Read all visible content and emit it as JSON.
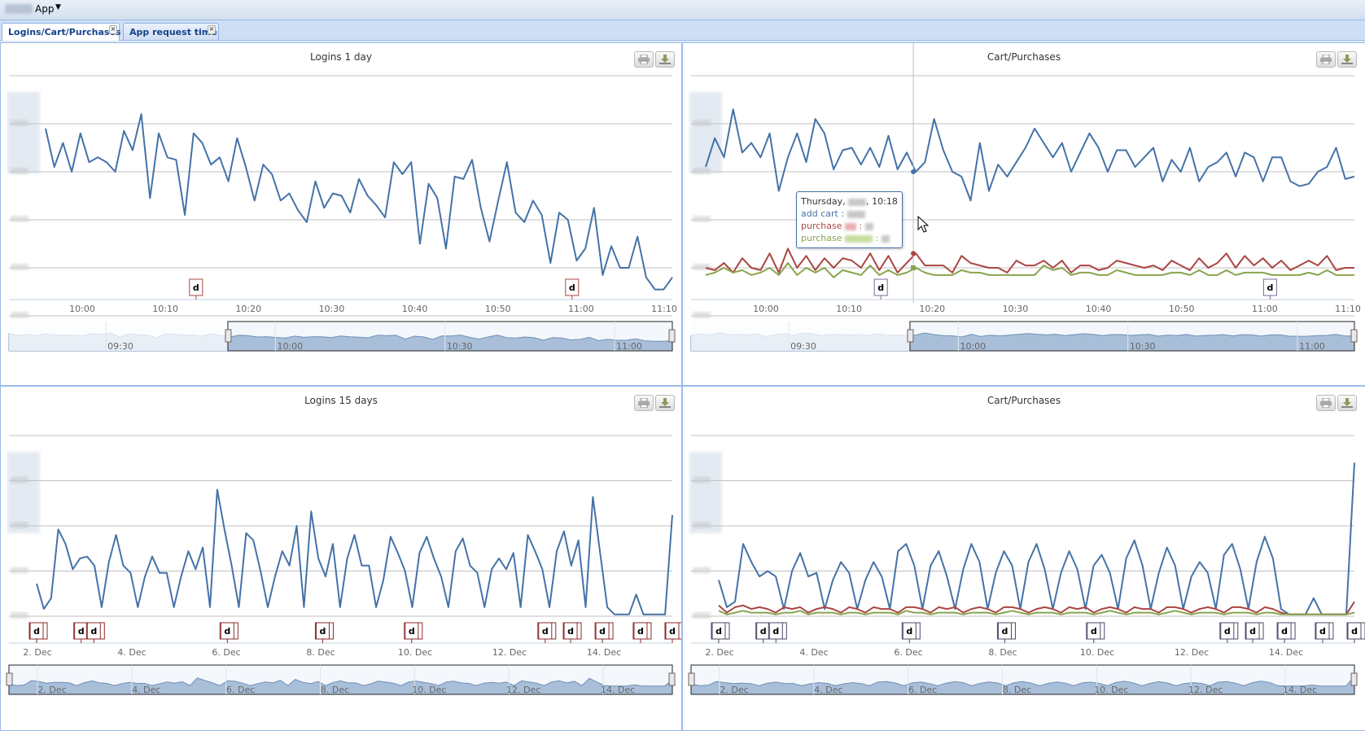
{
  "topbar": {
    "app_label": "App"
  },
  "tabs": [
    {
      "label": "Logins/Cart/Purchases",
      "active": true
    },
    {
      "label": "App request time",
      "active": false
    }
  ],
  "colors": {
    "blue": "#4572a7",
    "red": "#aa4643",
    "green": "#89a54e",
    "nav_fill": "#a9bfd9",
    "grid": "#c0c0c0"
  },
  "icons": {
    "print": "print-icon",
    "export": "download-icon"
  },
  "chart_data": [
    {
      "type": "line",
      "title": "Logins 1 day",
      "x_ticks": [
        "10:00",
        "10:10",
        "10:20",
        "10:30",
        "10:40",
        "10:50",
        "11:00",
        "11:10"
      ],
      "series": [
        {
          "color": "#4572a7",
          "values": [
            0.78,
            0.62,
            0.72,
            0.6,
            0.76,
            0.64,
            0.66,
            0.64,
            0.6,
            0.77,
            0.69,
            0.84,
            0.49,
            0.76,
            0.66,
            0.65,
            0.42,
            0.76,
            0.72,
            0.63,
            0.66,
            0.56,
            0.74,
            0.62,
            0.48,
            0.63,
            0.59,
            0.48,
            0.51,
            0.44,
            0.39,
            0.56,
            0.45,
            0.51,
            0.5,
            0.43,
            0.57,
            0.5,
            0.46,
            0.41,
            0.64,
            0.59,
            0.64,
            0.3,
            0.55,
            0.49,
            0.28,
            0.58,
            0.57,
            0.65,
            0.45,
            0.31,
            0.48,
            0.64,
            0.43,
            0.39,
            0.48,
            0.42,
            0.22,
            0.43,
            0.4,
            0.23,
            0.28,
            0.45,
            0.17,
            0.29,
            0.2,
            0.2,
            0.33,
            0.16,
            0.11,
            0.11,
            0.16
          ]
        }
      ],
      "flags": [
        {
          "label": "d",
          "t": 0.24
        },
        {
          "label": "d",
          "t": 0.84
        }
      ],
      "navigator": {
        "tick_labels": [
          "09:30",
          "10:00",
          "10:30",
          "11:00"
        ],
        "selection": [
          0.33,
          1.0
        ]
      }
    },
    {
      "type": "line",
      "title": "Cart/Purchases",
      "x_ticks": [
        "10:00",
        "10:10",
        "10:20",
        "10:30",
        "10:40",
        "10:50",
        "11:00",
        "11:10"
      ],
      "series": [
        {
          "name": "add cart",
          "color": "#4572a7",
          "values": [
            0.62,
            0.74,
            0.66,
            0.86,
            0.68,
            0.72,
            0.66,
            0.76,
            0.52,
            0.66,
            0.76,
            0.64,
            0.82,
            0.76,
            0.61,
            0.69,
            0.7,
            0.63,
            0.7,
            0.62,
            0.75,
            0.61,
            0.68,
            0.6,
            0.64,
            0.82,
            0.69,
            0.6,
            0.58,
            0.48,
            0.72,
            0.52,
            0.63,
            0.58,
            0.64,
            0.7,
            0.78,
            0.72,
            0.66,
            0.72,
            0.6,
            0.68,
            0.76,
            0.7,
            0.6,
            0.69,
            0.69,
            0.62,
            0.66,
            0.7,
            0.56,
            0.65,
            0.6,
            0.7,
            0.56,
            0.62,
            0.64,
            0.68,
            0.58,
            0.68,
            0.66,
            0.56,
            0.66,
            0.66,
            0.56,
            0.54,
            0.55,
            0.6,
            0.62,
            0.7,
            0.57,
            0.58
          ]
        },
        {
          "name": "purchase",
          "color": "#aa4643",
          "values": [
            0.2,
            0.19,
            0.22,
            0.18,
            0.24,
            0.2,
            0.19,
            0.26,
            0.18,
            0.28,
            0.2,
            0.25,
            0.19,
            0.24,
            0.2,
            0.24,
            0.23,
            0.2,
            0.26,
            0.19,
            0.25,
            0.18,
            0.22,
            0.26,
            0.21,
            0.21,
            0.21,
            0.18,
            0.25,
            0.22,
            0.21,
            0.2,
            0.2,
            0.18,
            0.23,
            0.21,
            0.21,
            0.23,
            0.2,
            0.23,
            0.18,
            0.21,
            0.21,
            0.19,
            0.2,
            0.23,
            0.22,
            0.21,
            0.2,
            0.21,
            0.19,
            0.23,
            0.21,
            0.19,
            0.24,
            0.2,
            0.22,
            0.26,
            0.2,
            0.25,
            0.21,
            0.24,
            0.2,
            0.23,
            0.19,
            0.21,
            0.23,
            0.21,
            0.25,
            0.19,
            0.2,
            0.2
          ]
        },
        {
          "name": "purchase",
          "color": "#89a54e",
          "values": [
            0.17,
            0.18,
            0.2,
            0.18,
            0.19,
            0.17,
            0.18,
            0.2,
            0.17,
            0.22,
            0.17,
            0.2,
            0.18,
            0.2,
            0.16,
            0.19,
            0.18,
            0.17,
            0.21,
            0.17,
            0.19,
            0.17,
            0.18,
            0.2,
            0.18,
            0.17,
            0.17,
            0.17,
            0.19,
            0.18,
            0.18,
            0.17,
            0.17,
            0.17,
            0.17,
            0.17,
            0.17,
            0.21,
            0.19,
            0.2,
            0.17,
            0.18,
            0.18,
            0.17,
            0.17,
            0.19,
            0.18,
            0.17,
            0.17,
            0.17,
            0.17,
            0.18,
            0.18,
            0.17,
            0.19,
            0.17,
            0.17,
            0.19,
            0.17,
            0.18,
            0.18,
            0.18,
            0.17,
            0.17,
            0.17,
            0.17,
            0.18,
            0.17,
            0.19,
            0.17,
            0.17,
            0.17
          ]
        }
      ],
      "flags": [
        {
          "label": "d",
          "t": 0.27
        },
        {
          "label": "d",
          "t": 0.87
        }
      ],
      "crosshair_t": 0.32,
      "navigator": {
        "tick_labels": [
          "09:30",
          "10:00",
          "10:30",
          "11:00"
        ],
        "selection": [
          0.33,
          1.0
        ]
      },
      "tooltip": {
        "day": "Thursday,",
        "time": ", 10:18",
        "rows": [
          {
            "name": "add cart",
            "color": "#4572a7"
          },
          {
            "name": "purchase",
            "color": "#aa4643"
          },
          {
            "name": "purchase",
            "color": "#89a54e"
          }
        ]
      }
    },
    {
      "type": "line",
      "title": "Logins 15 days",
      "x_ticks": [
        "2. Dec",
        "4. Dec",
        "6. Dec",
        "8. Dec",
        "10. Dec",
        "12. Dec",
        "14. Dec"
      ],
      "series": [
        {
          "color": "#4572a7",
          "values": [
            0.18,
            0.04,
            0.1,
            0.48,
            0.4,
            0.26,
            0.32,
            0.33,
            0.28,
            0.05,
            0.3,
            0.45,
            0.28,
            0.24,
            0.05,
            0.22,
            0.33,
            0.24,
            0.24,
            0.05,
            0.22,
            0.36,
            0.26,
            0.38,
            0.05,
            0.7,
            0.48,
            0.28,
            0.05,
            0.46,
            0.42,
            0.25,
            0.05,
            0.22,
            0.36,
            0.28,
            0.5,
            0.05,
            0.58,
            0.32,
            0.22,
            0.4,
            0.05,
            0.32,
            0.45,
            0.28,
            0.28,
            0.05,
            0.2,
            0.44,
            0.35,
            0.25,
            0.05,
            0.35,
            0.44,
            0.32,
            0.22,
            0.05,
            0.36,
            0.43,
            0.28,
            0.24,
            0.05,
            0.26,
            0.32,
            0.26,
            0.35,
            0.05,
            0.45,
            0.36,
            0.26,
            0.05,
            0.36,
            0.47,
            0.28,
            0.42,
            0.05,
            0.66,
            0.35,
            0.05,
            0.01,
            0.01,
            0.01,
            0.12,
            0.01,
            0.01,
            0.01,
            0.01,
            0.56
          ]
        }
      ],
      "flags": [
        {
          "label": "d",
          "t": 0.0
        },
        {
          "label": "d",
          "t": 0.07
        },
        {
          "label": "d",
          "t": 0.09
        },
        {
          "label": "d",
          "t": 0.3
        },
        {
          "label": "d",
          "t": 0.45
        },
        {
          "label": "d",
          "t": 0.59
        },
        {
          "label": "d",
          "t": 0.8
        },
        {
          "label": "d",
          "t": 0.84
        },
        {
          "label": "d",
          "t": 0.89
        },
        {
          "label": "d",
          "t": 0.95
        },
        {
          "label": "d",
          "t": 1.0
        }
      ],
      "navigator": {
        "tick_labels": [
          "2. Dec",
          "4. Dec",
          "6. Dec",
          "8. Dec",
          "10. Dec",
          "12. Dec",
          "14. Dec"
        ],
        "selection": [
          0.0,
          1.0
        ]
      }
    },
    {
      "type": "line",
      "title": "Cart/Purchases",
      "x_ticks": [
        "2. Dec",
        "4. Dec",
        "6. Dec",
        "8. Dec",
        "10. Dec",
        "12. Dec",
        "14. Dec"
      ],
      "series": [
        {
          "color": "#4572a7",
          "values": [
            0.2,
            0.05,
            0.08,
            0.4,
            0.3,
            0.22,
            0.25,
            0.22,
            0.04,
            0.25,
            0.35,
            0.22,
            0.24,
            0.04,
            0.2,
            0.3,
            0.24,
            0.04,
            0.2,
            0.3,
            0.22,
            0.04,
            0.36,
            0.4,
            0.28,
            0.04,
            0.28,
            0.36,
            0.22,
            0.04,
            0.26,
            0.4,
            0.3,
            0.04,
            0.24,
            0.36,
            0.28,
            0.04,
            0.3,
            0.4,
            0.26,
            0.04,
            0.24,
            0.36,
            0.26,
            0.04,
            0.28,
            0.34,
            0.24,
            0.04,
            0.32,
            0.42,
            0.28,
            0.04,
            0.24,
            0.38,
            0.28,
            0.04,
            0.22,
            0.3,
            0.24,
            0.04,
            0.34,
            0.4,
            0.26,
            0.04,
            0.3,
            0.44,
            0.32,
            0.04,
            0.01,
            0.01,
            0.01,
            0.1,
            0.01,
            0.01,
            0.01,
            0.01,
            0.85
          ]
        },
        {
          "color": "#aa4643",
          "values": [
            0.06,
            0.02,
            0.05,
            0.06,
            0.04,
            0.05,
            0.04,
            0.02,
            0.05,
            0.04,
            0.05,
            0.02,
            0.04,
            0.05,
            0.04,
            0.02,
            0.05,
            0.04,
            0.02,
            0.05,
            0.04,
            0.04,
            0.02,
            0.05,
            0.05,
            0.04,
            0.02,
            0.05,
            0.04,
            0.05,
            0.02,
            0.04,
            0.05,
            0.04,
            0.02,
            0.05,
            0.05,
            0.04,
            0.02,
            0.04,
            0.05,
            0.04,
            0.02,
            0.05,
            0.04,
            0.05,
            0.02,
            0.04,
            0.05,
            0.04,
            0.02,
            0.05,
            0.04,
            0.04,
            0.02,
            0.05,
            0.05,
            0.04,
            0.02,
            0.04,
            0.05,
            0.04,
            0.02,
            0.05,
            0.05,
            0.04,
            0.02,
            0.05,
            0.04,
            0.02,
            0.01,
            0.01,
            0.01,
            0.01,
            0.01,
            0.01,
            0.01,
            0.01,
            0.08
          ]
        },
        {
          "color": "#89a54e",
          "values": [
            0.03,
            0.01,
            0.02,
            0.03,
            0.02,
            0.02,
            0.02,
            0.01,
            0.02,
            0.02,
            0.03,
            0.01,
            0.02,
            0.02,
            0.02,
            0.01,
            0.02,
            0.02,
            0.01,
            0.02,
            0.02,
            0.02,
            0.01,
            0.03,
            0.02,
            0.02,
            0.01,
            0.02,
            0.02,
            0.02,
            0.01,
            0.02,
            0.02,
            0.02,
            0.01,
            0.02,
            0.03,
            0.02,
            0.01,
            0.02,
            0.02,
            0.02,
            0.01,
            0.02,
            0.02,
            0.02,
            0.01,
            0.02,
            0.03,
            0.02,
            0.01,
            0.02,
            0.02,
            0.02,
            0.01,
            0.02,
            0.03,
            0.02,
            0.01,
            0.02,
            0.02,
            0.02,
            0.01,
            0.02,
            0.02,
            0.02,
            0.01,
            0.02,
            0.02,
            0.01,
            0.01,
            0.01,
            0.01,
            0.01,
            0.01,
            0.01,
            0.01,
            0.01,
            0.02
          ]
        }
      ],
      "flags": [
        {
          "label": "d",
          "t": 0.0
        },
        {
          "label": "d",
          "t": 0.07
        },
        {
          "label": "d",
          "t": 0.09
        },
        {
          "label": "d",
          "t": 0.3
        },
        {
          "label": "d",
          "t": 0.45
        },
        {
          "label": "d",
          "t": 0.59
        },
        {
          "label": "d",
          "t": 0.8
        },
        {
          "label": "d",
          "t": 0.84
        },
        {
          "label": "d",
          "t": 0.89
        },
        {
          "label": "d",
          "t": 0.95
        },
        {
          "label": "d",
          "t": 1.0
        }
      ],
      "navigator": {
        "tick_labels": [
          "2. Dec",
          "4. Dec",
          "6. Dec",
          "8. Dec",
          "10. Dec",
          "12. Dec",
          "14. Dec"
        ],
        "selection": [
          0.0,
          1.0
        ]
      }
    }
  ]
}
